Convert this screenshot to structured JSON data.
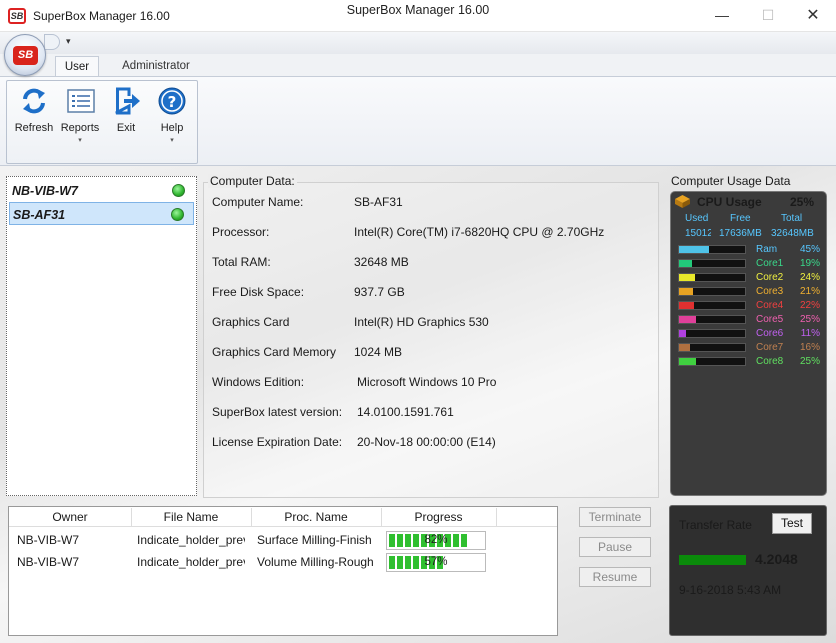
{
  "window": {
    "title": "SuperBox Manager 16.00",
    "app_logo": "SB",
    "minimize": "—",
    "maximize": "☐",
    "close": "✕"
  },
  "quick_access": {
    "title": "SuperBox Manager 16.00",
    "dropdown": "▾"
  },
  "tabs": [
    {
      "label": "User"
    },
    {
      "label": "Administrator"
    }
  ],
  "ribbon": {
    "buttons": [
      {
        "label": "Refresh",
        "icon": "refresh-icon"
      },
      {
        "label": "Reports",
        "icon": "report-icon",
        "dropdown": "▾"
      },
      {
        "label": "Exit",
        "icon": "exit-icon"
      },
      {
        "label": "Help",
        "icon": "help-icon",
        "dropdown": "▾"
      }
    ]
  },
  "machines": [
    {
      "name": "NB-VIB-W7",
      "status": "online"
    },
    {
      "name": "SB-AF31",
      "status": "online",
      "selected": true
    }
  ],
  "computer_data": {
    "title": "Computer Data:",
    "rows": [
      {
        "label": "Computer Name:",
        "value": "SB-AF31"
      },
      {
        "label": "Processor:",
        "value": "Intel(R) Core(TM) i7-6820HQ CPU @ 2.70GHz"
      },
      {
        "label": "Total RAM:",
        "value": "32648 MB"
      },
      {
        "label": "Free Disk Space:",
        "value": "937.7 GB"
      },
      {
        "label": "Graphics Card",
        "value": "Intel(R) HD Graphics 530"
      },
      {
        "label": "Graphics Card Memory",
        "value": "1024 MB"
      },
      {
        "label": "Windows Edition:",
        "value": "Microsoft Windows 10 Pro"
      },
      {
        "label": "SuperBox latest version:",
        "value": "14.0100.1591.761"
      },
      {
        "label": "License Expiration Date:",
        "value": "20-Nov-18 00:00:00 (E14)"
      }
    ]
  },
  "usage": {
    "title": "Computer Usage Data",
    "cpu_label": "CPU Usage",
    "cpu_percent": "25%",
    "memory": {
      "used_label": "Used",
      "free_label": "Free",
      "total_label": "Total",
      "used": "15012",
      "free": "17636MB",
      "total": "32648MB"
    },
    "bars": [
      {
        "label": "Ram",
        "percent": "45%",
        "value": 45,
        "color": "#4fc3e8",
        "text_color": "#57c7ff"
      },
      {
        "label": "Core1",
        "percent": "19%",
        "value": 19,
        "color": "#22c97a",
        "text_color": "#39d98a"
      },
      {
        "label": "Core2",
        "percent": "24%",
        "value": 24,
        "color": "#e8e82a",
        "text_color": "#f0f040"
      },
      {
        "label": "Core3",
        "percent": "21%",
        "value": 21,
        "color": "#e8a322",
        "text_color": "#f0b030"
      },
      {
        "label": "Core4",
        "percent": "22%",
        "value": 22,
        "color": "#e03030",
        "text_color": "#f04040"
      },
      {
        "label": "Core5",
        "percent": "25%",
        "value": 25,
        "color": "#e0409a",
        "text_color": "#f060b0"
      },
      {
        "label": "Core6",
        "percent": "11%",
        "value": 11,
        "color": "#b040e0",
        "text_color": "#c060f0"
      },
      {
        "label": "Core7",
        "percent": "16%",
        "value": 16,
        "color": "#b07040",
        "text_color": "#c08050"
      },
      {
        "label": "Core8",
        "percent": "25%",
        "value": 25,
        "color": "#40d040",
        "text_color": "#60e060"
      }
    ]
  },
  "jobs": {
    "columns": [
      "Owner",
      "File Name",
      "Proc. Name",
      "Progress"
    ],
    "rows": [
      {
        "owner": "NB-VIB-W7",
        "file": "Indicate_holder_prev",
        "proc": "Surface Milling-Finish",
        "progress": "82%",
        "value": 82
      },
      {
        "owner": "NB-VIB-W7",
        "file": "Indicate_holder_prev",
        "proc": "Volume Milling-Rough",
        "progress": "57%",
        "value": 57
      }
    ]
  },
  "job_buttons": {
    "terminate": "Terminate",
    "pause": "Pause",
    "resume": "Resume"
  },
  "transfer": {
    "label": "Transfer Rate",
    "test": "Test",
    "value": "4.2048",
    "date": "9-16-2018 5:43 AM"
  }
}
